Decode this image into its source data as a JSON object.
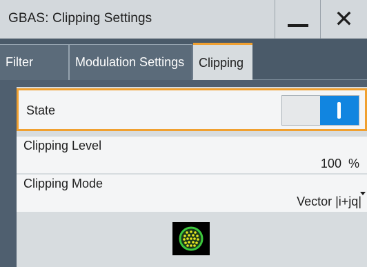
{
  "window": {
    "title": "GBAS: Clipping Settings",
    "minimize_icon": "minimize-icon",
    "close_icon": "close-icon",
    "close_glyph": "✕"
  },
  "tabs": [
    {
      "label": "Filter",
      "active": false
    },
    {
      "label": "Modulation Settings",
      "active": false
    },
    {
      "label": "Clipping",
      "active": true
    }
  ],
  "clipping": {
    "state_label": "State",
    "state_on": true,
    "level_label": "Clipping Level",
    "level_value": "100",
    "level_unit": "%",
    "mode_label": "Clipping Mode",
    "mode_value": "Vector |i+jq|"
  },
  "colors": {
    "accent_orange": "#f0a030",
    "toggle_blue": "#1185e0",
    "constellation_green": "#3cc83c"
  },
  "constellation_icon": "constellation-diagram-icon"
}
